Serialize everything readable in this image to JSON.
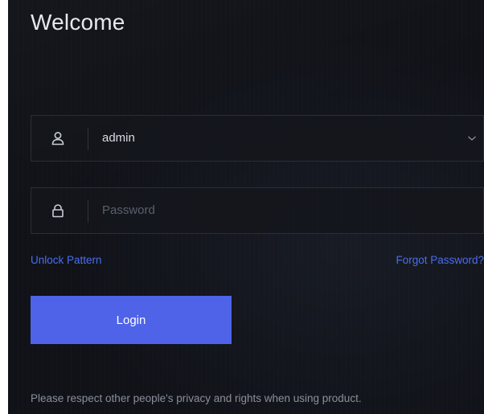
{
  "header": {
    "title": "Welcome"
  },
  "form": {
    "username": {
      "value": "admin",
      "icon": "user-icon"
    },
    "password": {
      "value": "",
      "placeholder": "Password",
      "icon": "lock-icon"
    }
  },
  "links": {
    "unlock_pattern": "Unlock Pattern",
    "forgot_password": "Forgot Password?"
  },
  "actions": {
    "login_label": "Login"
  },
  "footer": {
    "notice": "Please respect other people's privacy and rights when using product."
  },
  "colors": {
    "background": "#101218",
    "accent": "#4e63e8",
    "link": "#4a6df0"
  }
}
